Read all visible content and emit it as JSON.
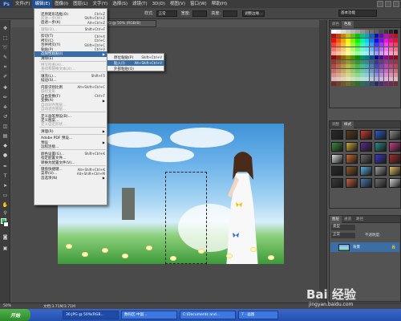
{
  "menubar": {
    "logo": "Ps",
    "items": [
      "文件(F)",
      "编辑(E)",
      "图像(I)",
      "图层(L)",
      "文字(Y)",
      "选择(S)",
      "滤镜(T)",
      "3D(D)",
      "视图(V)",
      "窗口(W)",
      "帮助(H)"
    ],
    "active_index": 1
  },
  "options": {
    "style_label": "样式:",
    "style_value": "正常",
    "width_label": "宽度:",
    "height_label": "高度:",
    "refine_button": "调整边缘...",
    "workspace": "基本功能"
  },
  "document_tab": "30.JPG @ 50% (RGB/8)",
  "edit_menu": {
    "items": [
      {
        "label": "还原矩形选框(O)",
        "shortcut": "Ctrl+Z",
        "disabled": false
      },
      {
        "label": "前进一步(W)",
        "shortcut": "Shift+Ctrl+Z",
        "disabled": true
      },
      {
        "label": "后退一步(K)",
        "shortcut": "Alt+Ctrl+Z",
        "disabled": false
      },
      {
        "sep": true
      },
      {
        "label": "渐隐(D)...",
        "shortcut": "Shift+Ctrl+F",
        "disabled": true
      },
      {
        "sep": true
      },
      {
        "label": "剪切(T)",
        "shortcut": "Ctrl+X",
        "disabled": false
      },
      {
        "label": "拷贝(C)",
        "shortcut": "Ctrl+C",
        "disabled": false
      },
      {
        "label": "合并拷贝(Y)",
        "shortcut": "Shift+Ctrl+C",
        "disabled": false
      },
      {
        "label": "粘贴(P)",
        "shortcut": "Ctrl+V",
        "disabled": false
      },
      {
        "label": "选择性粘贴(I)",
        "shortcut": "",
        "submenu": true,
        "highlight": true
      },
      {
        "label": "清除(E)",
        "shortcut": "",
        "disabled": false
      },
      {
        "sep": true
      },
      {
        "label": "拼写检查(H)...",
        "shortcut": "",
        "disabled": true
      },
      {
        "label": "查找和替换文本(X)...",
        "shortcut": "",
        "disabled": true
      },
      {
        "sep": true
      },
      {
        "label": "填充(L)...",
        "shortcut": "Shift+F5",
        "disabled": false
      },
      {
        "label": "描边(S)...",
        "shortcut": "",
        "disabled": false
      },
      {
        "sep": true
      },
      {
        "label": "内容识别比例",
        "shortcut": "Alt+Shift+Ctrl+C",
        "disabled": false
      },
      {
        "label": "操控变形",
        "shortcut": "",
        "disabled": true
      },
      {
        "label": "自由变换(F)",
        "shortcut": "Ctrl+T",
        "disabled": false
      },
      {
        "label": "变换(A)",
        "shortcut": "",
        "submenu": true
      },
      {
        "label": "自动对齐图层...",
        "shortcut": "",
        "disabled": true
      },
      {
        "label": "自动混合图层...",
        "shortcut": "",
        "disabled": true
      },
      {
        "sep": true
      },
      {
        "label": "定义画笔预设(B)...",
        "shortcut": "",
        "disabled": false
      },
      {
        "label": "定义图案...",
        "shortcut": "",
        "disabled": false
      },
      {
        "label": "定义自定形状...",
        "shortcut": "",
        "disabled": true
      },
      {
        "sep": true
      },
      {
        "label": "清理(R)",
        "shortcut": "",
        "submenu": true
      },
      {
        "sep": true
      },
      {
        "label": "Adobe PDF 预设...",
        "shortcut": "",
        "disabled": false
      },
      {
        "label": "预设",
        "shortcut": "",
        "submenu": true
      },
      {
        "label": "远程连接...",
        "shortcut": "",
        "disabled": false
      },
      {
        "sep": true
      },
      {
        "label": "颜色设置(G)...",
        "shortcut": "Shift+Ctrl+K",
        "disabled": false
      },
      {
        "label": "指定配置文件...",
        "shortcut": "",
        "disabled": false
      },
      {
        "label": "转换为配置文件(V)...",
        "shortcut": "",
        "disabled": false
      },
      {
        "sep": true
      },
      {
        "label": "键盘快捷键...",
        "shortcut": "Alt+Shift+Ctrl+K",
        "disabled": false
      },
      {
        "label": "菜单(U)...",
        "shortcut": "Alt+Shift+Ctrl+M",
        "disabled": false
      },
      {
        "label": "首选项(N)",
        "shortcut": "",
        "submenu": true
      }
    ]
  },
  "submenu": {
    "items": [
      {
        "label": "原位粘贴(P)",
        "shortcut": "Shift+Ctrl+V",
        "highlight": false
      },
      {
        "label": "贴入(I)",
        "shortcut": "Alt+Shift+Ctrl+V",
        "highlight": true
      },
      {
        "label": "外部粘贴(O)",
        "shortcut": "",
        "highlight": false
      }
    ]
  },
  "panels": {
    "color_tabs": [
      "颜色",
      "色板"
    ],
    "adjust_tabs": [
      "调整",
      "样式"
    ],
    "layers_tabs": [
      "图层",
      "通道",
      "路径"
    ],
    "layer_kind": "类型",
    "blend_mode": "正常",
    "opacity_label": "不透明度:",
    "layer_name": "背景"
  },
  "statusbar": {
    "zoom": "50%",
    "doc_info": "文档:3.71M/3.71M"
  },
  "taskbar": {
    "start": "开始",
    "tasks": [
      "30.JPG @ 50%(RGB...",
      "数码区-中国...",
      "C:\\Documents and...",
      "7 - 画图"
    ],
    "active_index": 0
  },
  "watermark": {
    "text": "Bai 经验",
    "url": "jingyan.baidu.com"
  },
  "colors": {
    "menu_highlight": "#3a6ea5",
    "foreground_color": "#1fd050",
    "background_color": "#ffffff"
  }
}
